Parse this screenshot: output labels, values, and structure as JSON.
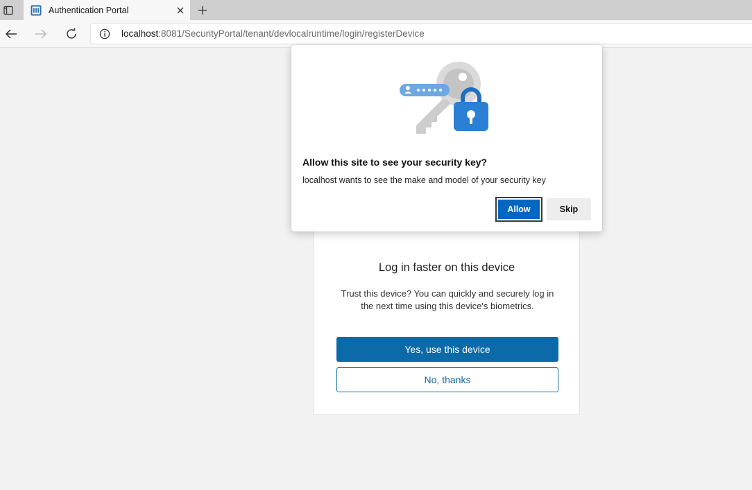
{
  "browser": {
    "tab": {
      "title": "Authentication Portal",
      "favicon": "portal-favicon"
    },
    "address": {
      "host": "localhost",
      "rest": ":8081/SecurityPortal/tenant/devlocalruntime/login/registerDevice"
    },
    "icons": {
      "tab_actions": "tab-actions-icon",
      "close": "close-icon",
      "new_tab": "plus-icon",
      "back": "back-arrow-icon",
      "forward": "forward-arrow-icon",
      "reload": "reload-icon",
      "site_info": "info-icon"
    }
  },
  "permission_prompt": {
    "title": "Allow this site to see your security key?",
    "description": "localhost wants to see the make and model of your security key",
    "allow_label": "Allow",
    "skip_label": "Skip",
    "illustration": "security-key-lock-illustration"
  },
  "device_card": {
    "title": "Log in faster on this device",
    "description": "Trust this device? You can quickly and securely log in the next time using this device's biometrics.",
    "primary_label": "Yes, use this device",
    "secondary_label": "No, thanks"
  },
  "colors": {
    "primary": "#0d6aa8",
    "allow": "#0067c0",
    "page_bg": "#f2f2f2"
  }
}
